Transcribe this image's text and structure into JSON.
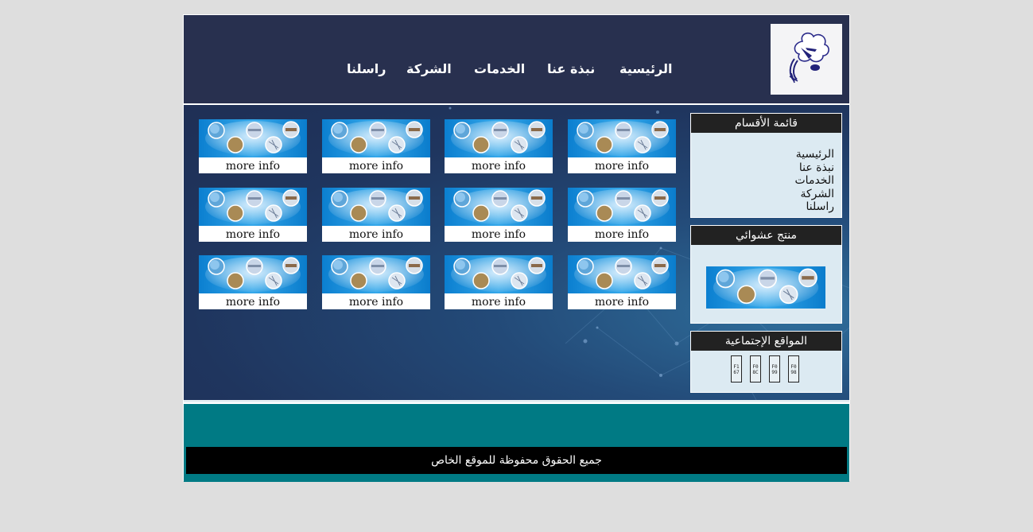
{
  "nav": {
    "items": [
      "الرئيسية",
      "نبذة عنا",
      "الخدمات",
      "الشركة",
      "راسلنا"
    ]
  },
  "products": {
    "more_label": "more info",
    "count": 12
  },
  "sidebar": {
    "categories": {
      "title": "قائمة الأقسام",
      "items": [
        "الرئيسية",
        "نبذة عنا",
        "الخدمات",
        "الشركة",
        "راسلنا"
      ]
    },
    "random_product": {
      "title": "منتج عشوائي"
    },
    "social": {
      "title": "المواقع الإجتماعية",
      "codes": [
        "F1 67",
        "F0 8C",
        "F0 99",
        "F0 98"
      ]
    }
  },
  "footer": {
    "copyright": "جميع الحقوق محفوظة للموقع الخاص"
  },
  "colors": {
    "header_bg": "#28304f",
    "footer_bg": "#007a84",
    "sidebar_box_bg": "#dceaf2",
    "box_title_bg": "#222222",
    "page_bg": "#dedede"
  }
}
